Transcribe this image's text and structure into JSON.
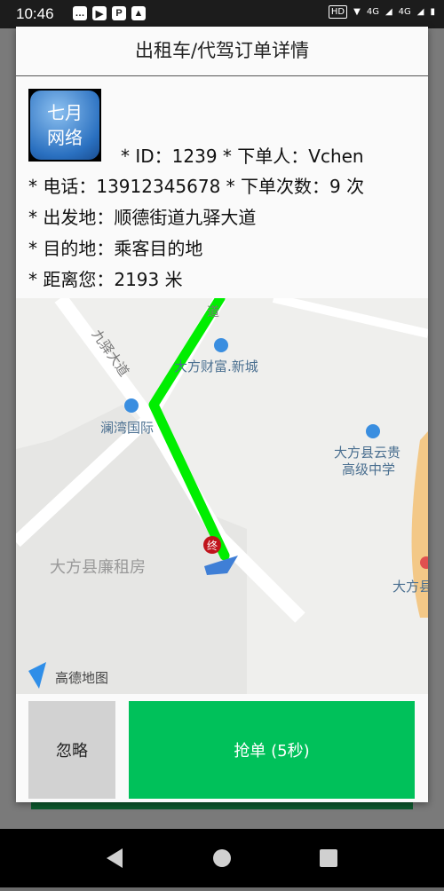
{
  "status_bar": {
    "time": "10:46",
    "network_1": "4G",
    "network_2": "4G",
    "hd": "HD"
  },
  "dialog": {
    "title": "出租车/代驾订单详情",
    "avatar": {
      "line1": "七月",
      "line2": "网络"
    },
    "info": {
      "line1": "* ID：1239 * 下单人：Vchen",
      "line2": "* 电话：13912345678 * 下单次数：9 次",
      "line3": "* 出发地：顺德街道九驿大道",
      "line4": "* 目的地：乘客目的地",
      "line5": "* 距离您：2193 米"
    },
    "map": {
      "labels": {
        "road": "九驿大道",
        "road_top": "道",
        "poi1": "大方财富.新城",
        "poi2": "澜湾国际",
        "poi3_line1": "大方县云贵",
        "poi3_line2": "高级中学",
        "poi4": "大方县廉租房",
        "poi5": "大方县",
        "end_marker": "终",
        "logo": "高德地图"
      },
      "route_color": "#00ee00"
    },
    "buttons": {
      "ignore": "忽略",
      "grab": "抢单 (5秒)"
    }
  },
  "colors": {
    "accent": "#00c15a",
    "route": "#00ee00"
  }
}
